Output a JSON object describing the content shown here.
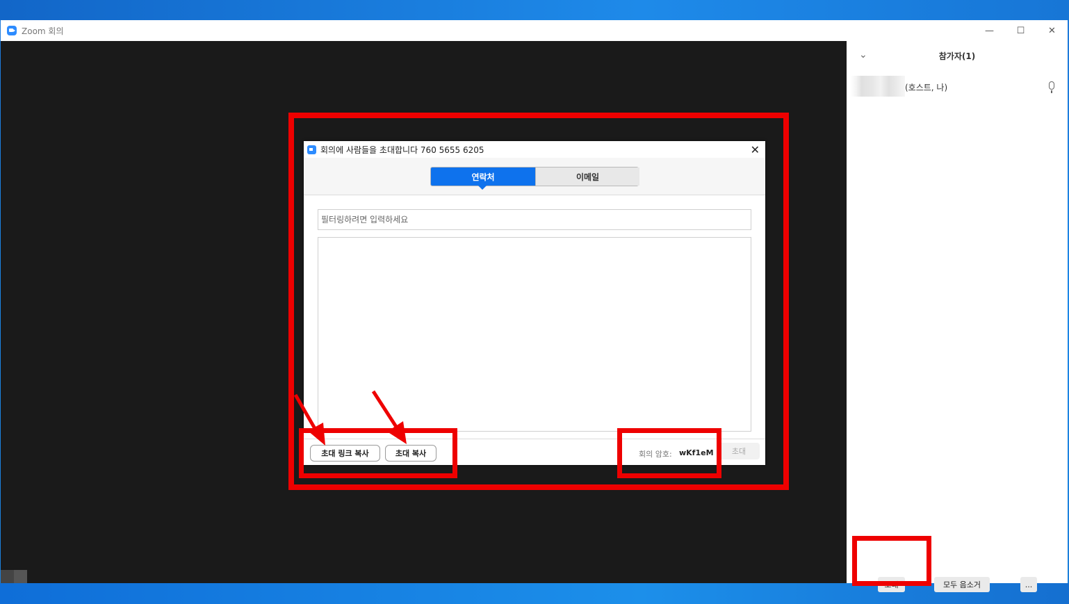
{
  "window": {
    "title": "Zoom 회의",
    "controls": {
      "minimize": "—",
      "maximize": "☐",
      "close": "✕"
    }
  },
  "dialog": {
    "title": "회의에 사람들을 초대합니다 760 5655 6205",
    "close": "✕",
    "tabs": [
      {
        "label": "연락처",
        "active": true
      },
      {
        "label": "이메일",
        "active": false
      }
    ],
    "filter_placeholder": "필터링하려면 입력하세요",
    "footer": {
      "copy_link_button": "초대 링크 복사",
      "copy_invite_button": "초대 복사",
      "password_label": "회의 암호:",
      "password_value": "wKf1eM",
      "invite_button": "초대"
    }
  },
  "participants_panel": {
    "chevron": "⌄",
    "title": "참가자(1)",
    "participants": [
      {
        "name": "(호스트, 나)"
      }
    ],
    "buttons": {
      "invite": "초대",
      "mute_all": "모두 음소거",
      "more": "..."
    }
  },
  "colors": {
    "zoom_blue": "#2d8cff",
    "tab_active": "#0e72ed",
    "annotation_red": "#ee0000",
    "video_background": "#1a1a1a"
  },
  "icons": [
    "zoom-app-icon",
    "close-icon",
    "chevron-down-icon",
    "microphone-icon"
  ]
}
